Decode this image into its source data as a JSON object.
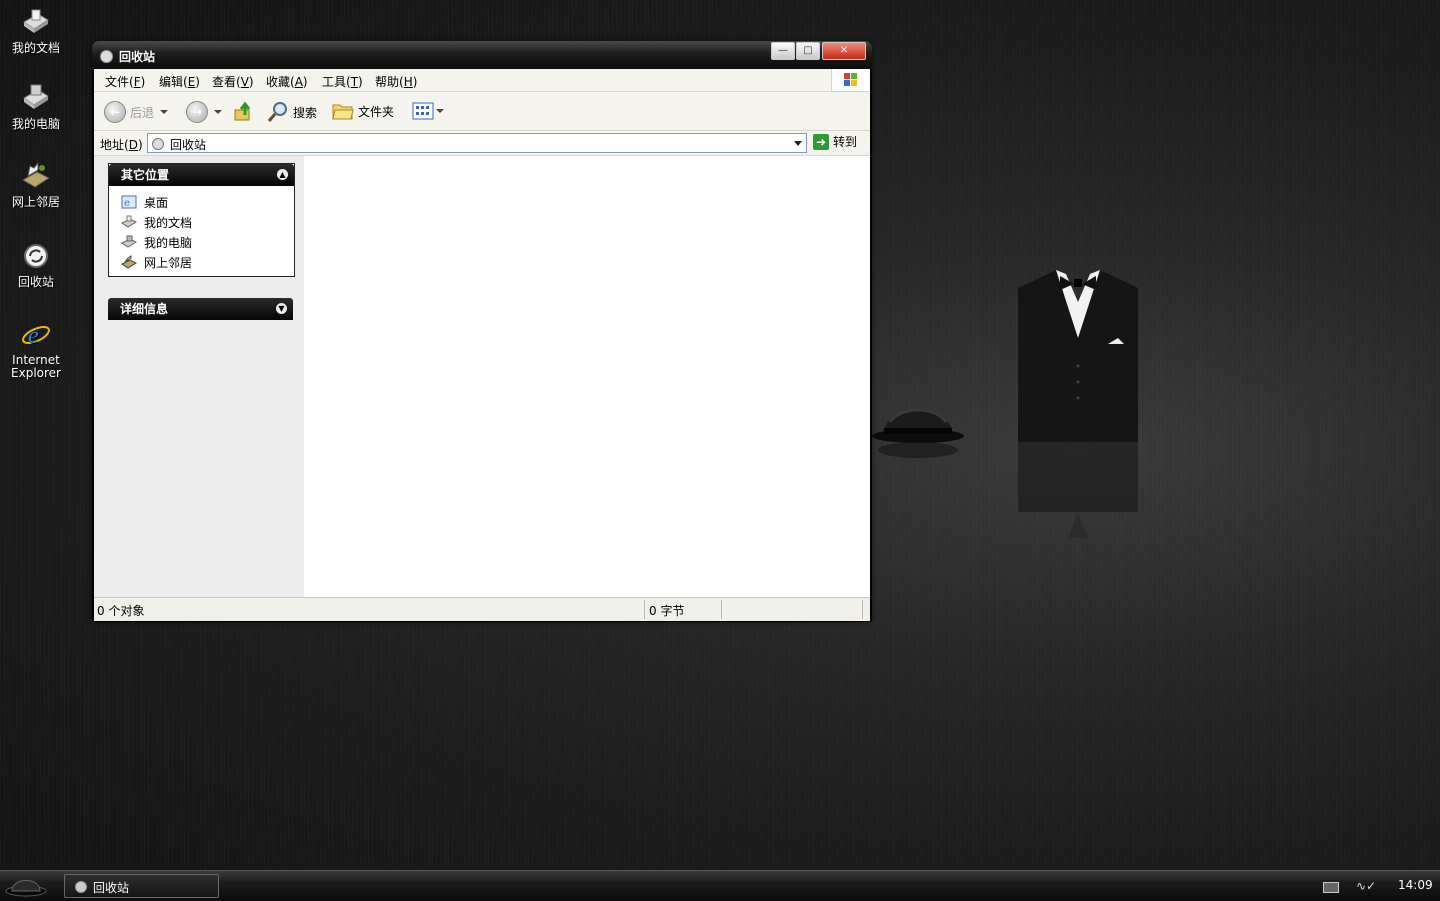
{
  "desktop": {
    "icons": [
      {
        "label": "我的文档",
        "icon": "my-documents-icon"
      },
      {
        "label": "我的电脑",
        "icon": "my-computer-icon"
      },
      {
        "label": "网上邻居",
        "icon": "network-places-icon"
      },
      {
        "label": "回收站",
        "icon": "recycle-bin-icon"
      },
      {
        "label": "Internet Explorer",
        "icon": "ie-icon"
      }
    ]
  },
  "window": {
    "title": "回收站",
    "menu": [
      {
        "label": "文件",
        "key": "F"
      },
      {
        "label": "编辑",
        "key": "E"
      },
      {
        "label": "查看",
        "key": "V"
      },
      {
        "label": "收藏",
        "key": "A"
      },
      {
        "label": "工具",
        "key": "T"
      },
      {
        "label": "帮助",
        "key": "H"
      }
    ],
    "toolbar": {
      "back_label": "后退",
      "search_label": "搜索",
      "folders_label": "文件夹"
    },
    "address": {
      "label": "地址",
      "key": "D",
      "value": "回收站",
      "go_label": "转到"
    },
    "sidebar": {
      "other_places": {
        "title": "其它位置",
        "items": [
          {
            "label": "桌面",
            "icon": "desktop-icon"
          },
          {
            "label": "我的文档",
            "icon": "my-documents-icon"
          },
          {
            "label": "我的电脑",
            "icon": "my-computer-icon"
          },
          {
            "label": "网上邻居",
            "icon": "network-places-icon"
          }
        ]
      },
      "details": {
        "title": "详细信息"
      }
    },
    "status": {
      "objects": "0 个对象",
      "size": "0 字节"
    }
  },
  "taskbar": {
    "task_label": "回收站",
    "clock": "14:09"
  },
  "colors": {
    "go_button": "#2e9a36",
    "close_button": "#c02a17",
    "titlebar": "#0c0c0c"
  }
}
